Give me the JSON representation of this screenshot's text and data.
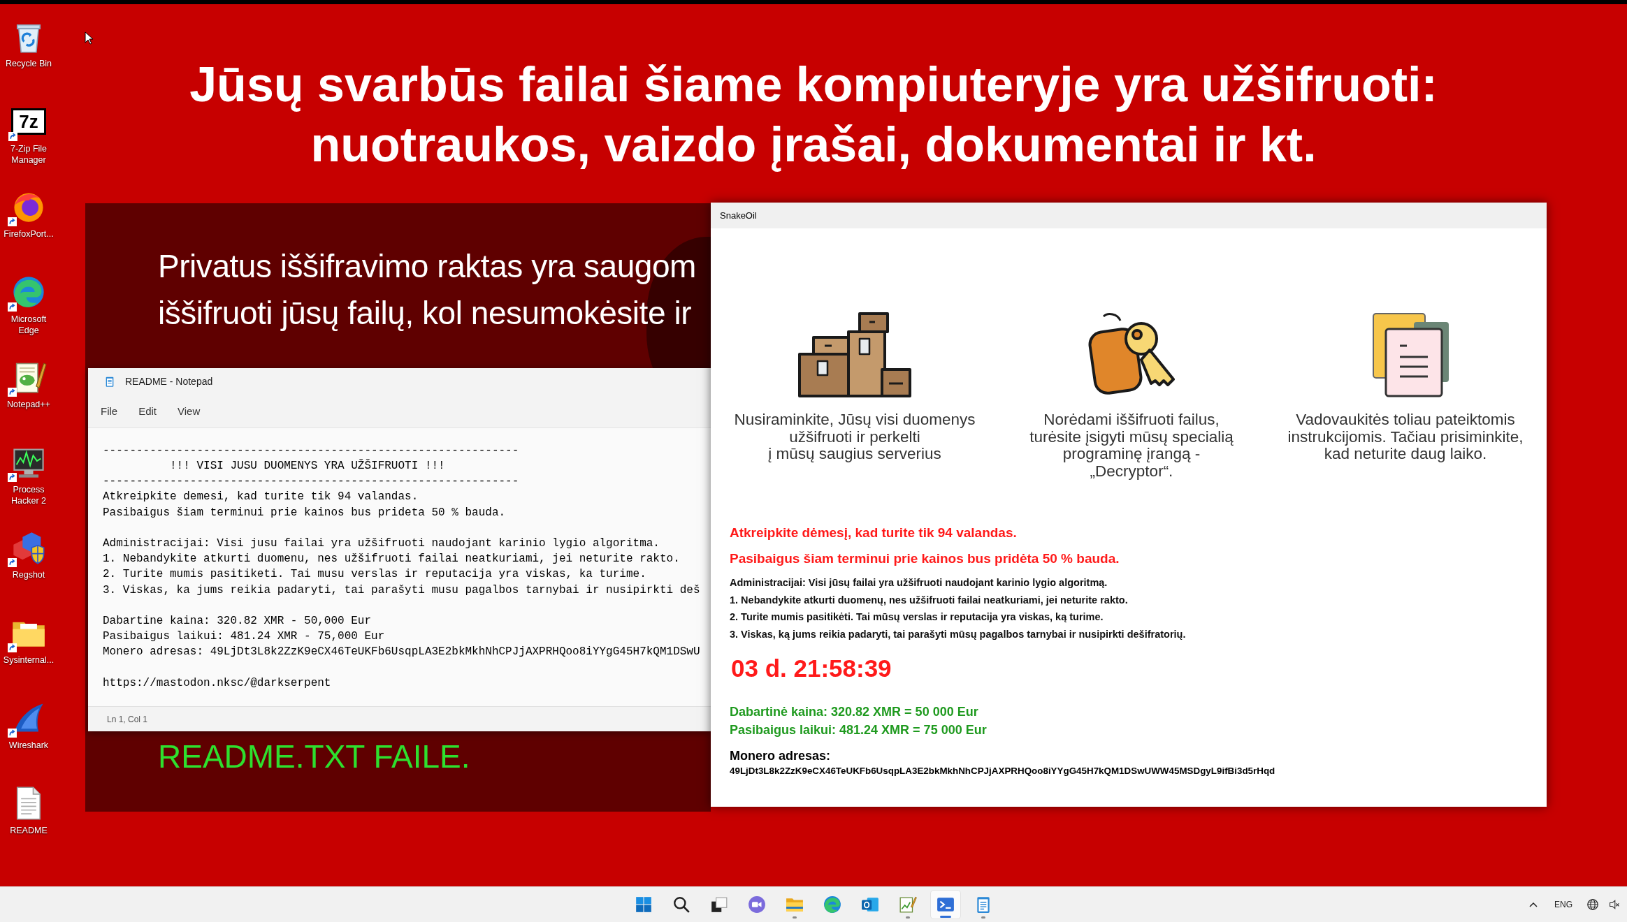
{
  "desktop": {
    "icons": [
      {
        "kind": "recycle-bin",
        "label": "Recycle Bin",
        "shortcut": false
      },
      {
        "kind": "archiver",
        "logo": "7z",
        "label": "7-Zip File Manager",
        "shortcut": true
      },
      {
        "kind": "flame-globe",
        "label": "FirefoxPort...",
        "shortcut": true
      },
      {
        "kind": "swirl-globe",
        "label": "Microsoft Edge",
        "shortcut": true
      },
      {
        "kind": "notepad-lizard",
        "label": "Notepad++",
        "shortcut": true
      },
      {
        "kind": "monitor-graph",
        "label": "Process Hacker 2",
        "shortcut": true
      },
      {
        "kind": "cubes-shield",
        "label": "Regshot",
        "shortcut": true
      },
      {
        "kind": "folder",
        "label": "Sysinternal...",
        "shortcut": true
      },
      {
        "kind": "shark-fin",
        "label": "Wireshark",
        "shortcut": true
      },
      {
        "kind": "text-file",
        "label": "README",
        "shortcut": false
      }
    ]
  },
  "banner": {
    "text": "Jūsų svarbūs failai šiame kompiuteryje yra užšifruoti:\nnuotraukos, vaizdo įrašai, dokumentai ir kt."
  },
  "background_window": {
    "message": "Privatus iššifravimo raktas yra saugom\niššifruoti jūsų failų, kol nesumokėsite ir",
    "footer": "README.TXT FAILE."
  },
  "notepad": {
    "title": "README - Notepad",
    "menu": [
      "File",
      "Edit",
      "View"
    ],
    "blocks": [
      [
        "--------------------------------------------------------------",
        "          !!! VISI JUSU DUOMENYS YRA UŽŠIFRUOTI !!!",
        "--------------------------------------------------------------",
        "Atkreipkite demesi, kad turite tik 94 valandas.",
        "Pasibaigus šiam terminui prie kainos bus prideta 50 % bauda."
      ],
      [
        "Administracijai: Visi jusu failai yra užšifruoti naudojant karinio lygio algoritma.",
        "1. Nebandykite atkurti duomenu, nes užšifruoti failai neatkuriami, jei neturite rakto.",
        "2. Turite mumis pasitiketi. Tai musu verslas ir reputacija yra viskas, ka turime.",
        "3. Viskas, ka jums reikia padaryti, tai parašyti musu pagalbos tarnybai ir nusipirkti deš"
      ],
      [
        "Dabartine kaina: 320.82 XMR - 50,000 Eur",
        "Pasibaigus laikui: 481.24 XMR - 75,000 Eur",
        "Monero adresas: 49LjDt3L8k2ZzK9eCX46TeUKFb6UsqpLA3E2bkMkhNhCPJjAXPRHQoo8iYYgG45H7kQM1DSwU"
      ],
      [
        "https://mastodon.nksc/@darkserpent"
      ]
    ],
    "status": "Ln 1, Col 1"
  },
  "ransom_window": {
    "title": "SnakeOil",
    "features": [
      {
        "kind": "boxes",
        "caption": "Nusiraminkite, Jūsų visi duomenys\nužšifruoti ir perkelti\nį mūsų saugius serverius"
      },
      {
        "kind": "key-tag",
        "caption": "Norėdami iššifruoti failus,\nturėsite įsigyti mūsų specialią\nprograminę įrangą -\n„Decryptor“."
      },
      {
        "kind": "documents",
        "caption": "Vadovaukitės toliau pateiktomis\ninstrukcijomis. Tačiau prisiminkite,\nkad neturite daug laiko."
      }
    ],
    "warnings": [
      "Atkreipkite dėmesį, kad turite tik 94 valandas.",
      "Pasibaigus šiam terminui prie kainos bus pridėta 50 % bauda."
    ],
    "instructions": [
      "Administracijai: Visi jūsų failai yra užšifruoti naudojant karinio lygio algoritmą.",
      "1. Nebandykite atkurti duomenų, nes užšifruoti failai neatkuriami, jei neturite rakto.",
      "2. Turite mumis pasitikėti. Tai mūsų verslas ir reputacija yra viskas, ką turime.",
      "3. Viskas, ką jums reikia padaryti, tai parašyti mūsų pagalbos tarnybai ir nusipirkti dešifratorių."
    ],
    "countdown": "03 d. 21:58:39",
    "prices": [
      "Dabartinė kaina: 320.82 XMR = 50 000 Eur",
      "Pasibaigus laikui: 481.24 XMR = 75 000 Eur"
    ],
    "address_label": "Monero adresas:",
    "address": "49LjDt3L8k2ZzK9eCX46TeUKFb6UsqpLA3E2bkMkhNhCPJjAXPRHQoo8iYYgG45H7kQM1DSwUWW45MSDgyL9ifBi3d5rHqd"
  },
  "taskbar": {
    "apps": [
      {
        "kind": "start",
        "running": false,
        "selected": false
      },
      {
        "kind": "search",
        "running": false,
        "selected": false
      },
      {
        "kind": "task-view",
        "running": false,
        "selected": false
      },
      {
        "kind": "chat",
        "running": false,
        "selected": false
      },
      {
        "kind": "folder",
        "running": true,
        "selected": false
      },
      {
        "kind": "swirl-globe",
        "running": false,
        "selected": false
      },
      {
        "kind": "mail",
        "running": false,
        "selected": false
      },
      {
        "kind": "chart-pencil",
        "running": true,
        "selected": false
      },
      {
        "kind": "terminal",
        "running": true,
        "selected": true
      },
      {
        "kind": "notepad",
        "running": true,
        "selected": false
      }
    ],
    "language": "ENG"
  }
}
